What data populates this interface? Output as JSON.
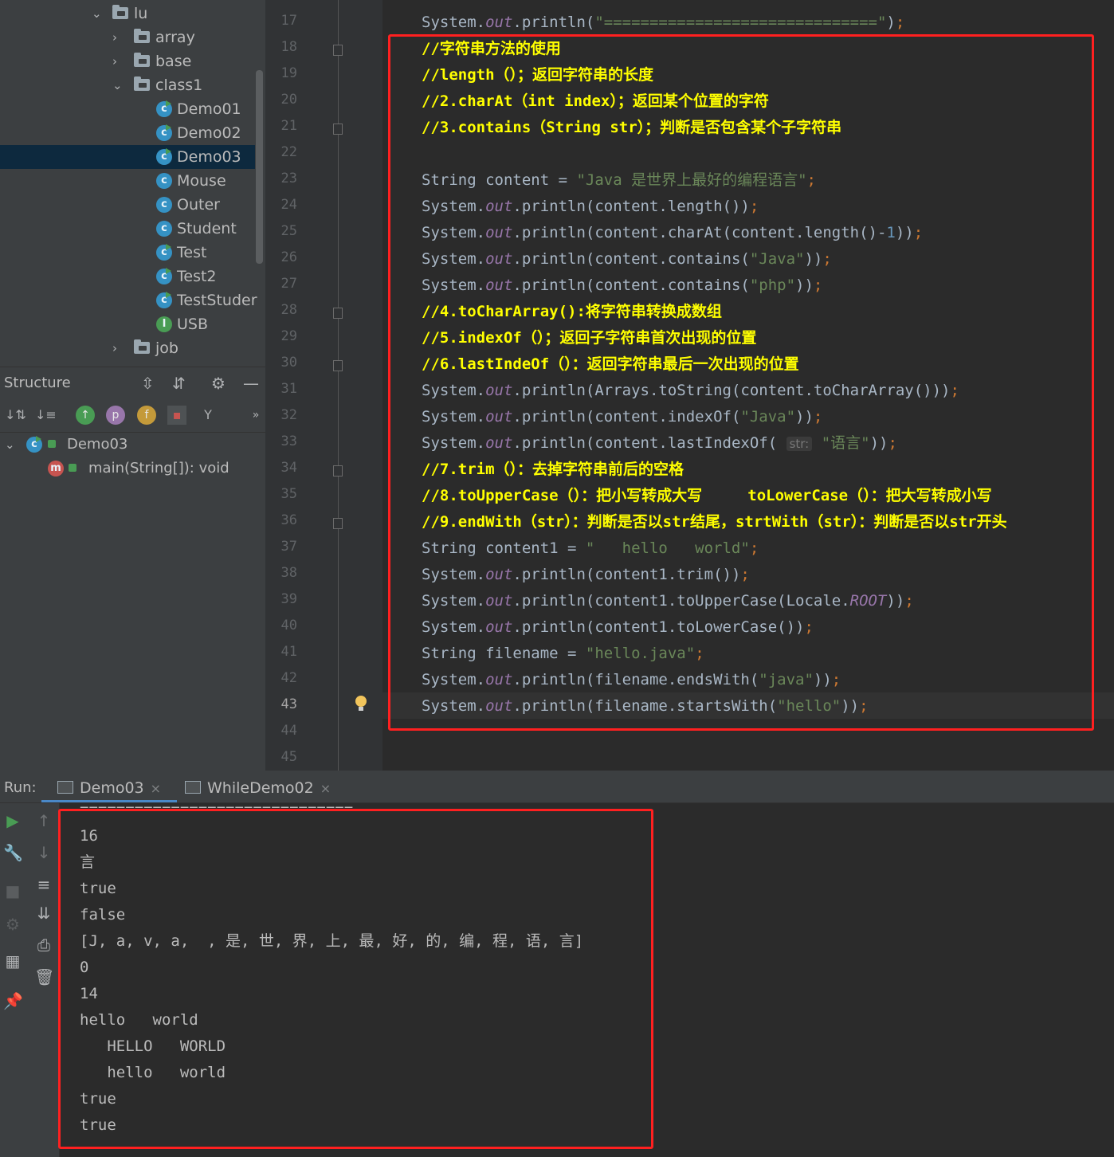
{
  "project_tree": {
    "items": [
      {
        "label": "lu",
        "kind": "package",
        "expanded": true
      },
      {
        "label": "array",
        "kind": "package",
        "expanded": false
      },
      {
        "label": "base",
        "kind": "package",
        "expanded": false
      },
      {
        "label": "class1",
        "kind": "package",
        "expanded": true
      },
      {
        "label": "Demo01",
        "kind": "runnable-class"
      },
      {
        "label": "Demo02",
        "kind": "runnable-class"
      },
      {
        "label": "Demo03",
        "kind": "runnable-class",
        "selected": true
      },
      {
        "label": "Mouse",
        "kind": "class"
      },
      {
        "label": "Outer",
        "kind": "class"
      },
      {
        "label": "Student",
        "kind": "class"
      },
      {
        "label": "Test",
        "kind": "runnable-class"
      },
      {
        "label": "Test2",
        "kind": "runnable-class"
      },
      {
        "label": "TestStuder",
        "kind": "runnable-class"
      },
      {
        "label": "USB",
        "kind": "interface"
      },
      {
        "label": "job",
        "kind": "package",
        "expanded": false
      }
    ]
  },
  "structure": {
    "title": "Structure",
    "class_name": "Demo03",
    "method": "main(String[]): void",
    "toolbar_icons": [
      "sort-by-visibility-icon",
      "sort-alphabetically-icon",
      "show-inherited-icon",
      "show-properties-icon",
      "show-fields-icon",
      "show-non-public-icon",
      "show-lambdas-icon",
      "more-icon"
    ]
  },
  "editor": {
    "line_numbers": [
      "17",
      "18",
      "19",
      "20",
      "21",
      "22",
      "23",
      "24",
      "25",
      "26",
      "27",
      "28",
      "29",
      "30",
      "31",
      "32",
      "33",
      "34",
      "35",
      "36",
      "37",
      "38",
      "39",
      "40",
      "41",
      "42",
      "43",
      "44",
      "45"
    ],
    "current_line": "43",
    "lines": {
      "l17": "System.out.println(\"==============================\");",
      "l18": "//字符串方法的使用",
      "l19": "//length（）；返回字符串的长度",
      "l20": "//2.charAt（int index）；返回某个位置的字符",
      "l21": "//3.contains（String str）；判断是否包含某个子字符串",
      "l23": "String content = \"Java 是世界上最好的编程语言\";",
      "l24": "System.out.println(content.length());",
      "l25": "System.out.println(content.charAt(content.length()-1));",
      "l26": "System.out.println(content.contains(\"Java\"));",
      "l27": "System.out.println(content.contains(\"php\"));",
      "l28": "//4.toCharArray():将字符串转换成数组",
      "l29": "//5.indexOf（）；返回子字符串首次出现的位置",
      "l30": "//6.lastIndeOf（）：返回字符串最后一次出现的位置",
      "l31": "System.out.println(Arrays.toString(content.toCharArray()));",
      "l32": "System.out.println(content.indexOf(\"Java\"));",
      "l33": "System.out.println(content.lastIndexOf( str: \"语言\"));",
      "l34": "//7.trim（）：去掉字符串前后的空格",
      "l35": "//8.toUpperCase（）：把小写转成大写     toLowerCase（）：把大写转成小写",
      "l36": "//9.endWith（str）：判断是否以str结尾，strtWith（str）：判断是否以str开头",
      "l37": "String content1 = \"   hello   world\";",
      "l38": "System.out.println(content1.trim());",
      "l39": "System.out.println(content1.toUpperCase(Locale.ROOT));",
      "l40": "System.out.println(content1.toLowerCase());",
      "l41": "String filename = \"hello.java\";",
      "l42": "System.out.println(filename.endsWith(\"java\"));",
      "l43": "System.out.println(filename.startsWith(\"hello\"));"
    }
  },
  "run_panel": {
    "label": "Run:",
    "tabs": [
      {
        "label": "Demo03",
        "active": true
      },
      {
        "label": "WhileDemo02",
        "active": false
      }
    ],
    "close_glyph": "×",
    "output": [
      "==============================",
      "16",
      "言",
      "true",
      "false",
      "[J, a, v, a,  , 是, 世, 界, 上, 最, 好, 的, 编, 程, 语, 言]",
      "0",
      "14",
      "hello   world",
      "   HELLO   WORLD",
      "   hello   world",
      "true",
      "true"
    ]
  },
  "colors": {
    "highlight_box": "#ff2020",
    "comment": "#ffff00",
    "string": "#6a8759",
    "keyword": "#cc7832",
    "static_field": "#9876aa",
    "number": "#6897bb",
    "code_text": "#a9b7c6",
    "selection": "#0d293e"
  }
}
